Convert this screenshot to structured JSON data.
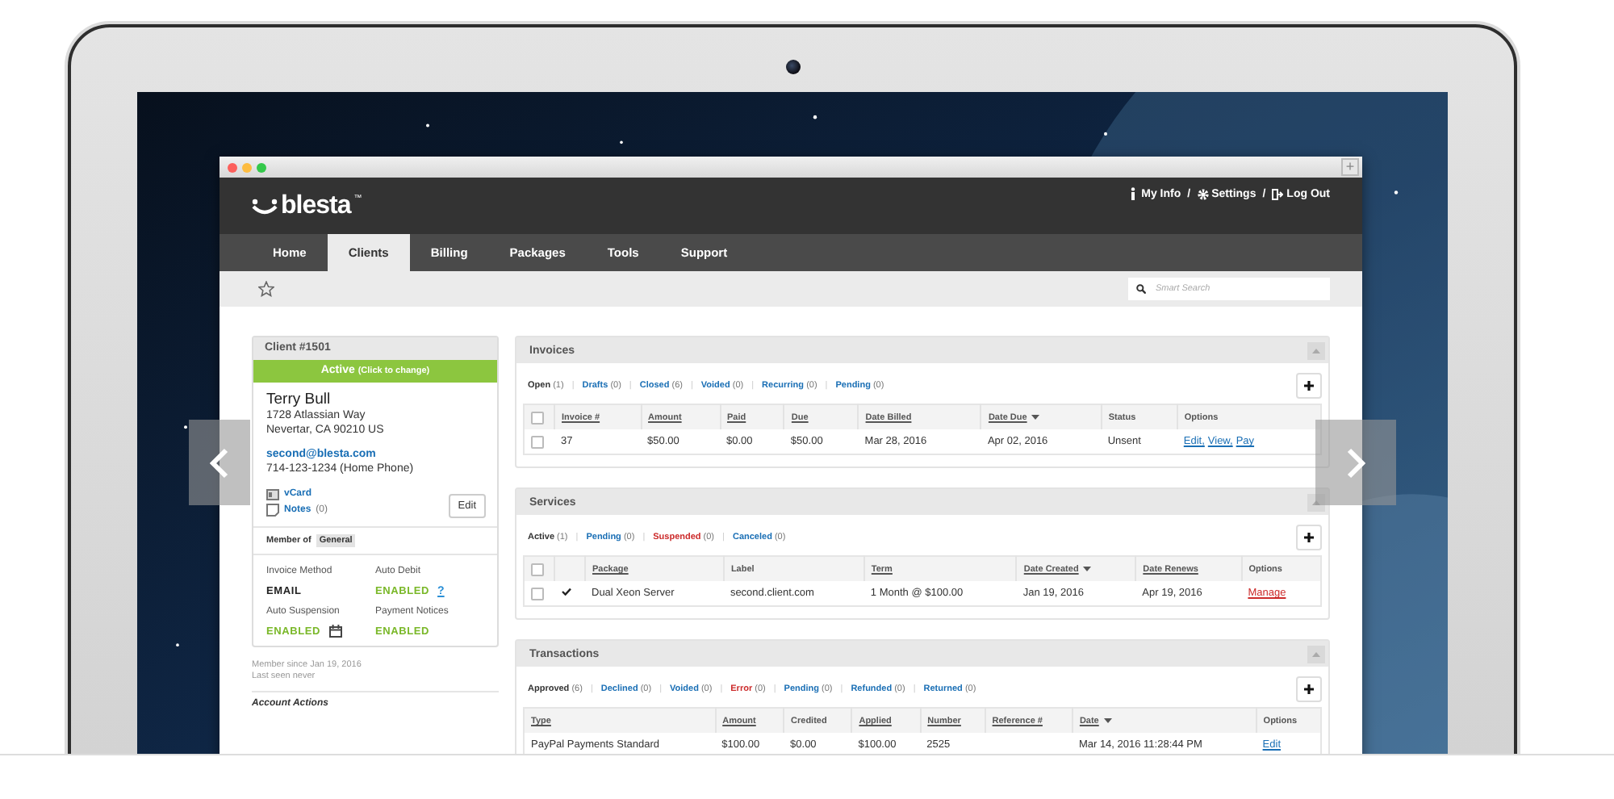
{
  "browser": {
    "new_tab": "+"
  },
  "header": {
    "logo": "blesta",
    "trademark": "™",
    "separator": "/",
    "links": [
      {
        "kind": "info",
        "label": "My Info"
      },
      {
        "kind": "gear",
        "label": "Settings"
      },
      {
        "kind": "logout",
        "label": "Log Out"
      }
    ]
  },
  "nav": [
    {
      "label": "Home",
      "selected": false
    },
    {
      "label": "Clients",
      "selected": true
    },
    {
      "label": "Billing",
      "selected": false
    },
    {
      "label": "Packages",
      "selected": false
    },
    {
      "label": "Tools",
      "selected": false
    },
    {
      "label": "Support",
      "selected": false
    }
  ],
  "search": {
    "placeholder": "Smart Search"
  },
  "client": {
    "title": "Client #1501",
    "status": "Active",
    "status_hint": "(Click to change)",
    "active": true,
    "name": "Terry Bull",
    "address": [
      "1728 Atlassian Way",
      "Nevertar, CA 90210 US"
    ],
    "email": "second@blesta.com",
    "phone": "714-123-1234 (Home Phone)",
    "links": [
      {
        "kind": "vcard",
        "label": "vCard"
      },
      {
        "kind": "notes",
        "label": "Notes",
        "count": "(0)"
      }
    ],
    "edit": "Edit",
    "member_label": "Member of",
    "group": "General",
    "settings": [
      {
        "label": "Invoice Method",
        "value": "EMAIL",
        "kind": "text"
      },
      {
        "label": "Auto Debit",
        "value": "ENABLED",
        "kind": "help",
        "help": "?"
      },
      {
        "label": "Auto Suspension",
        "value": "ENABLED",
        "kind": "schedule"
      },
      {
        "label": "Payment Notices",
        "value": "ENABLED",
        "kind": "enabled"
      }
    ],
    "member_since": "Member since Jan 19, 2016",
    "last_seen": "Last seen never",
    "actions_title": "Account Actions"
  },
  "panels": [
    {
      "title": "Invoices",
      "separator": "|",
      "filters": [
        {
          "label": "Open",
          "count": "(1)",
          "selected": true
        },
        {
          "label": "Drafts",
          "count": "(0)",
          "selected": false,
          "color": "#1a6fb5"
        },
        {
          "label": "Closed",
          "count": "(6)",
          "selected": false,
          "color": "#1a6fb5"
        },
        {
          "label": "Voided",
          "count": "(0)",
          "selected": false,
          "color": "#1a6fb5"
        },
        {
          "label": "Recurring",
          "count": "(0)",
          "selected": false,
          "color": "#1a6fb5"
        },
        {
          "label": "Pending",
          "count": "(0)",
          "selected": false,
          "color": "#1a6fb5"
        }
      ],
      "table": {
        "checkboxes": true,
        "select_all": false,
        "status_icon": false,
        "columns": [
          {
            "label": "Invoice #",
            "sortable": true,
            "sorted": false
          },
          {
            "label": "Amount",
            "sortable": true,
            "sorted": false
          },
          {
            "label": "Paid",
            "sortable": true,
            "sorted": false
          },
          {
            "label": "Due",
            "sortable": true,
            "sorted": false
          },
          {
            "label": "Date Billed",
            "sortable": true,
            "sorted": false
          },
          {
            "label": "Date Due",
            "sortable": true,
            "sorted": true
          },
          {
            "label": "Status",
            "sortable": false,
            "sorted": false
          },
          {
            "label": "Options",
            "sortable": false,
            "sorted": false
          }
        ],
        "rows": [
          {
            "checked": false,
            "cells": [
              "37",
              "$50.00",
              "$0.00",
              "$50.00",
              "Mar 28, 2016",
              "Apr 02, 2016",
              "Unsent"
            ],
            "options": [
              {
                "label": "Edit,",
                "color": "#1a6fb5"
              },
              {
                "label": "View,",
                "color": "#1a6fb5"
              },
              {
                "label": "Pay",
                "color": "#1a6fb5"
              }
            ]
          }
        ]
      }
    },
    {
      "title": "Services",
      "separator": "|",
      "filters": [
        {
          "label": "Active",
          "count": "(1)",
          "selected": true
        },
        {
          "label": "Pending",
          "count": "(0)",
          "selected": false,
          "color": "#1a6fb5"
        },
        {
          "label": "Suspended",
          "count": "(0)",
          "selected": false,
          "color": "#cc2b2b"
        },
        {
          "label": "Canceled",
          "count": "(0)",
          "selected": false,
          "color": "#1a6fb5"
        }
      ],
      "table": {
        "checkboxes": true,
        "select_all": false,
        "status_icon": true,
        "columns": [
          {
            "label": "Package",
            "sortable": true,
            "sorted": false
          },
          {
            "label": "Label",
            "sortable": false,
            "sorted": false
          },
          {
            "label": "Term",
            "sortable": true,
            "sorted": false
          },
          {
            "label": "Date Created",
            "sortable": true,
            "sorted": true
          },
          {
            "label": "Date Renews",
            "sortable": true,
            "sorted": false
          },
          {
            "label": "Options",
            "sortable": false,
            "sorted": false
          }
        ],
        "rows": [
          {
            "checked": false,
            "cells": [
              "Dual Xeon Server",
              "second.client.com",
              "1 Month @ $100.00",
              "Jan 19, 2016",
              "Apr 19, 2016"
            ],
            "options": [
              {
                "label": "Manage",
                "color": "#cc2b2b"
              }
            ]
          }
        ]
      }
    },
    {
      "title": "Transactions",
      "separator": "|",
      "filters": [
        {
          "label": "Approved",
          "count": "(6)",
          "selected": true
        },
        {
          "label": "Declined",
          "count": "(0)",
          "selected": false,
          "color": "#1a6fb5"
        },
        {
          "label": "Voided",
          "count": "(0)",
          "selected": false,
          "color": "#1a6fb5"
        },
        {
          "label": "Error",
          "count": "(0)",
          "selected": false,
          "color": "#cc2b2b"
        },
        {
          "label": "Pending",
          "count": "(0)",
          "selected": false,
          "color": "#1a6fb5"
        },
        {
          "label": "Refunded",
          "count": "(0)",
          "selected": false,
          "color": "#1a6fb5"
        },
        {
          "label": "Returned",
          "count": "(0)",
          "selected": false,
          "color": "#1a6fb5"
        }
      ],
      "table": {
        "checkboxes": false,
        "status_icon": false,
        "columns": [
          {
            "label": "Type",
            "sortable": true,
            "sorted": false
          },
          {
            "label": "Amount",
            "sortable": true,
            "sorted": false
          },
          {
            "label": "Credited",
            "sortable": false,
            "sorted": false
          },
          {
            "label": "Applied",
            "sortable": true,
            "sorted": false
          },
          {
            "label": "Number",
            "sortable": true,
            "sorted": false
          },
          {
            "label": "Reference #",
            "sortable": true,
            "sorted": false
          },
          {
            "label": "Date",
            "sortable": true,
            "sorted": true
          },
          {
            "label": "Options",
            "sortable": false,
            "sorted": false
          }
        ],
        "rows": [
          {
            "cells": [
              "PayPal Payments Standard",
              "$100.00",
              "$0.00",
              "$100.00",
              "2525",
              null,
              "Mar 14, 2016 11:28:44 PM"
            ],
            "options": [
              {
                "label": "Edit",
                "color": "#1a6fb5"
              }
            ]
          }
        ]
      }
    }
  ]
}
